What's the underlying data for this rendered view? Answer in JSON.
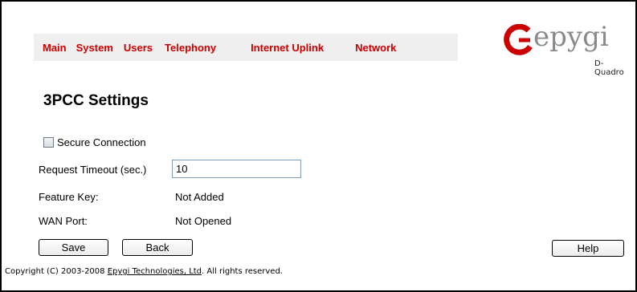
{
  "nav": {
    "items": [
      {
        "label": "Main"
      },
      {
        "label": "System"
      },
      {
        "label": "Users"
      },
      {
        "label": "Telephony"
      },
      {
        "label": "Internet Uplink"
      },
      {
        "label": "Network"
      }
    ]
  },
  "logo": {
    "brand": "epygi",
    "model": "D-Quadro"
  },
  "page": {
    "title": "3PCC Settings"
  },
  "form": {
    "secure_connection": {
      "label": "Secure Connection",
      "checked": false
    },
    "request_timeout": {
      "label": "Request Timeout (sec.)",
      "value": "10"
    },
    "feature_key": {
      "label": "Feature Key:",
      "value": "Not Added"
    },
    "wan_port": {
      "label": "WAN Port:",
      "value": "Not Opened"
    }
  },
  "buttons": {
    "save": "Save",
    "back": "Back",
    "help": "Help"
  },
  "footer": {
    "prefix": "Copyright (C) 2003-2008 ",
    "link": "Epygi Technologies, Ltd",
    "suffix": ". All rights reserved."
  },
  "colors": {
    "nav_text": "#cc0000",
    "nav_bg": "#efefef",
    "logo_red": "#cc0000",
    "logo_gray": "#8a8a8a"
  }
}
